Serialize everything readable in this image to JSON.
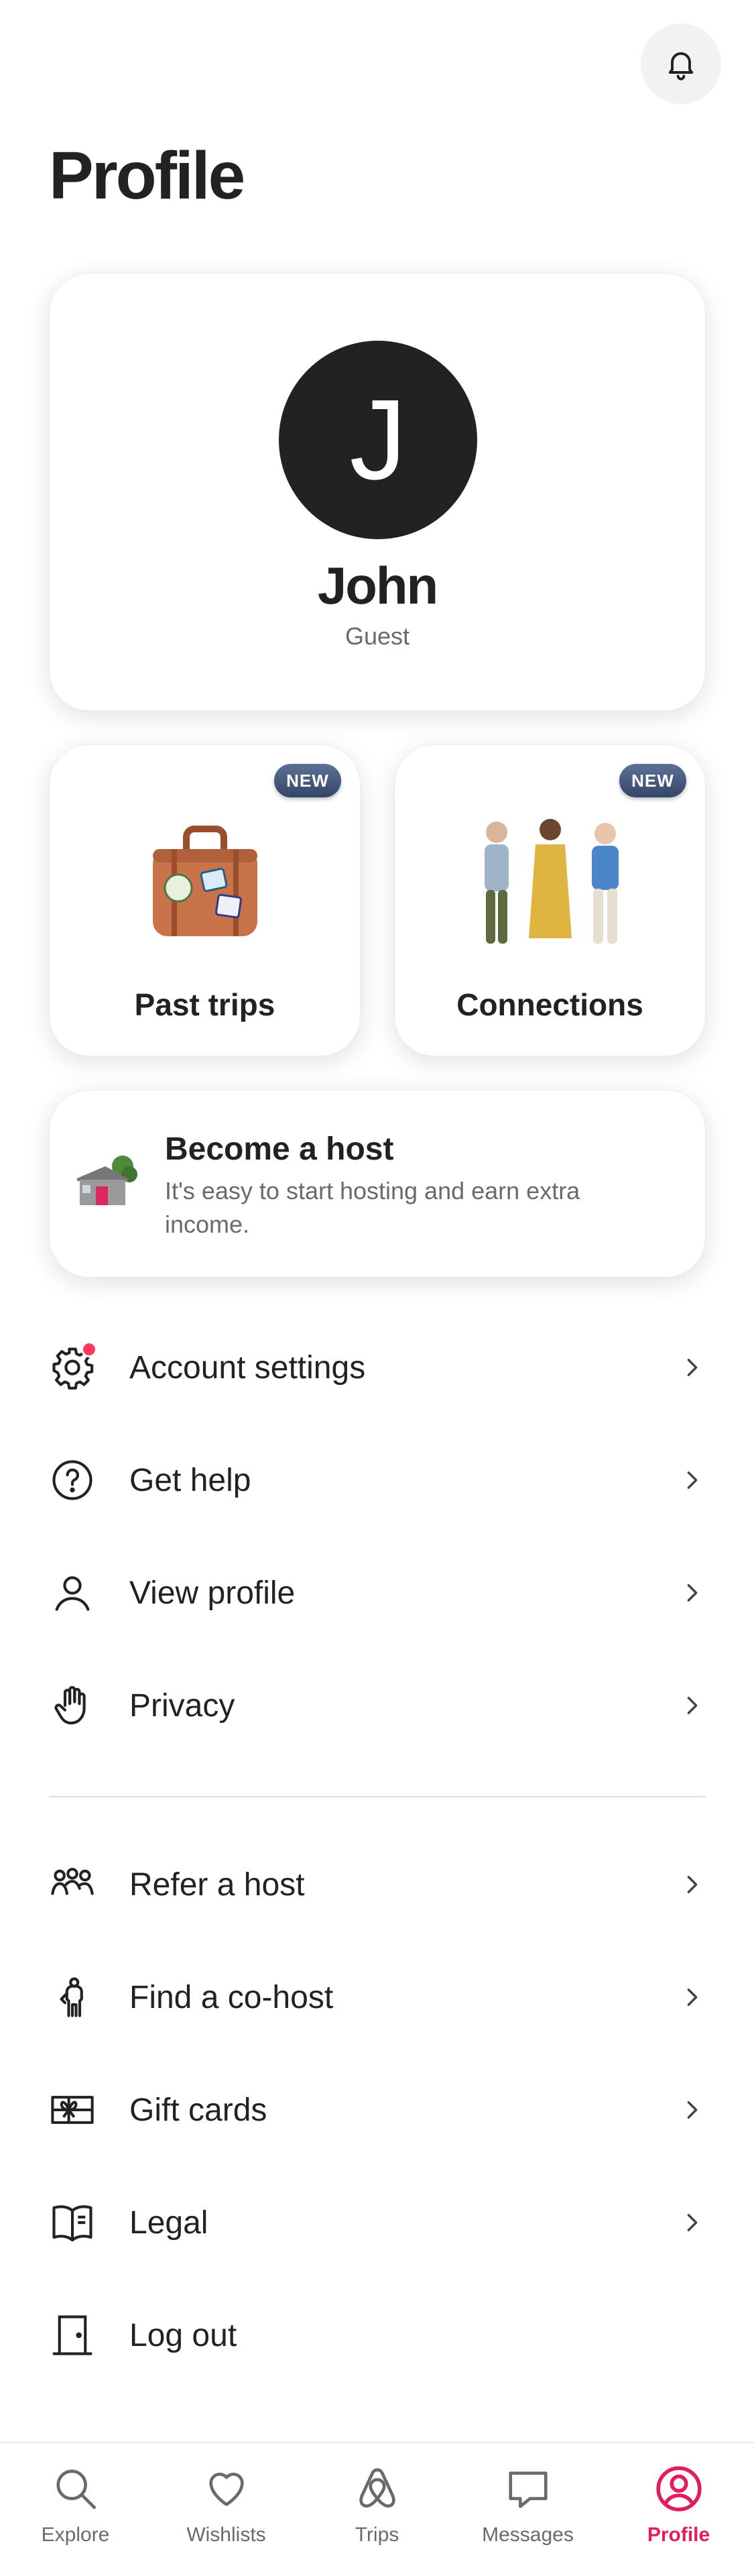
{
  "header": {
    "title": "Profile",
    "notifications_icon": "bell-icon"
  },
  "profile": {
    "initial": "J",
    "name": "John",
    "role": "Guest"
  },
  "tiles": [
    {
      "label": "Past trips",
      "badge": "NEW",
      "icon": "suitcase-illustration"
    },
    {
      "label": "Connections",
      "badge": "NEW",
      "icon": "people-illustration"
    }
  ],
  "host_card": {
    "title": "Become a host",
    "subtitle": "It's easy to start hosting and earn extra income.",
    "icon": "house-illustration"
  },
  "menu": {
    "account_settings": "Account settings",
    "get_help": "Get help",
    "view_profile": "View profile",
    "privacy": "Privacy",
    "refer_host": "Refer a host",
    "find_cohost": "Find a co-host",
    "gift_cards": "Gift cards",
    "legal": "Legal",
    "log_out": "Log out"
  },
  "tabbar": {
    "explore": "Explore",
    "wishlists": "Wishlists",
    "trips": "Trips",
    "messages": "Messages",
    "profile": "Profile",
    "active": "Profile"
  },
  "colors": {
    "accent": "#E31C5F",
    "notification_dot": "#FF385C",
    "badge": "#3E5275",
    "text": "#222222",
    "muted": "#6A6A6A"
  }
}
